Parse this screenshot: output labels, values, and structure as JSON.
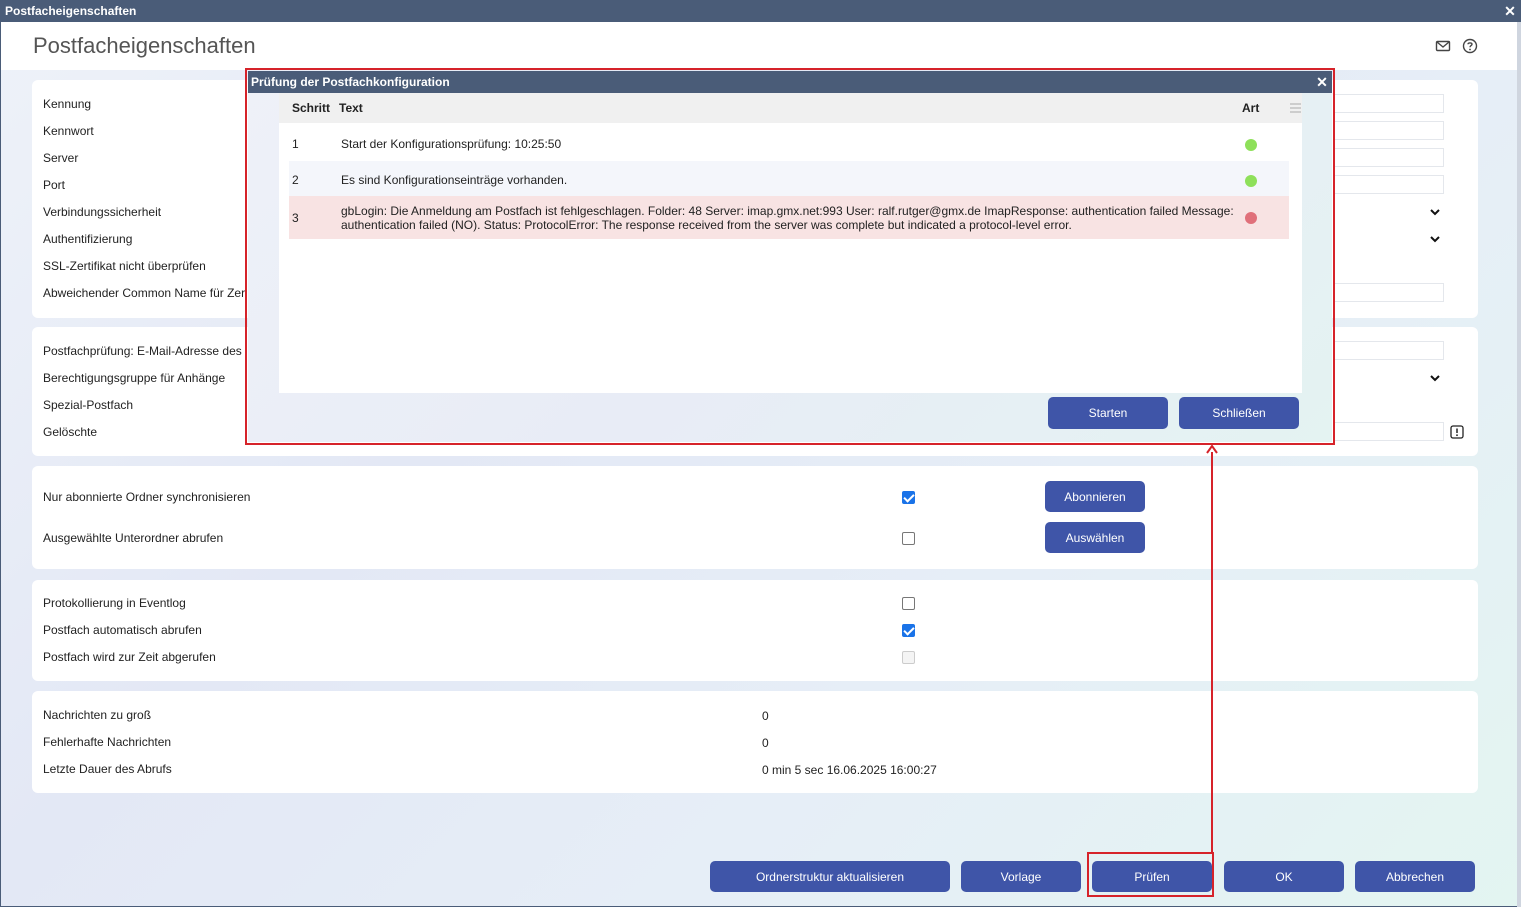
{
  "window": {
    "title": "Postfacheigenschaften",
    "close_glyph": "✕"
  },
  "page": {
    "title": "Postfacheigenschaften",
    "icons": [
      "mail-icon",
      "help-icon"
    ]
  },
  "section1": {
    "labels": [
      "Kennung",
      "Kennwort",
      "Server",
      "Port",
      "Verbindungssicherheit",
      "Authentifizierung",
      "SSL-Zertifikat nicht überprüfen",
      "Abweichender Common Name für Zer"
    ]
  },
  "section2": {
    "labels": [
      "Postfachprüfung: E-Mail-Adresse des",
      "Berechtigungsgruppe für Anhänge",
      "Spezial-Postfach",
      "Gelöschte"
    ]
  },
  "section3": {
    "rows": [
      {
        "label": "Nur abonnierte Ordner synchronisieren",
        "checked": true,
        "button": "Abonnieren"
      },
      {
        "label": "Ausgewählte Unterordner abrufen",
        "checked": false,
        "button": "Auswählen"
      }
    ]
  },
  "section4": {
    "rows": [
      {
        "label": "Protokollierung in Eventlog",
        "checked": false,
        "disabled": false
      },
      {
        "label": "Postfach automatisch abrufen",
        "checked": true,
        "disabled": false
      },
      {
        "label": "Postfach wird zur Zeit abgerufen",
        "checked": false,
        "disabled": true
      }
    ]
  },
  "section5": {
    "rows": [
      {
        "label": "Nachrichten zu groß",
        "value": "0"
      },
      {
        "label": "Fehlerhafte Nachrichten",
        "value": "0"
      },
      {
        "label": "Letzte Dauer des Abrufs",
        "value": "0 min 5 sec 16.06.2025 16:00:27"
      }
    ]
  },
  "footer": {
    "buttons": [
      "Ordnerstruktur aktualisieren",
      "Vorlage",
      "Prüfen",
      "OK",
      "Abbrechen"
    ]
  },
  "dialog": {
    "title": "Prüfung der Postfachkonfiguration",
    "columns": [
      "Schritt",
      "Text",
      "Art"
    ],
    "rows": [
      {
        "step": "1",
        "text": "Start der Konfigurationsprüfung: 10:25:50",
        "status": "ok"
      },
      {
        "step": "2",
        "text": "Es sind Konfigurationseinträge vorhanden.",
        "status": "ok"
      },
      {
        "step": "3",
        "text": "gbLogin: Die Anmeldung am Postfach ist fehlgeschlagen. Folder: 48 Server: imap.gmx.net:993 User: ralf.rutger@gmx.de ImapResponse: authentication failed Message: authentication failed (NO). Status: ProtocolError: The response received from the server was complete but indicated a protocol-level error.",
        "status": "error"
      }
    ],
    "buttons": {
      "start": "Starten",
      "close": "Schließen"
    }
  },
  "colors": {
    "accent": "#3f55a8",
    "titlebar": "#4a5c78",
    "ok": "#8ee05a",
    "error": "#e0707a",
    "error_row": "#f8e3e3",
    "highlight": "#d6232a"
  }
}
